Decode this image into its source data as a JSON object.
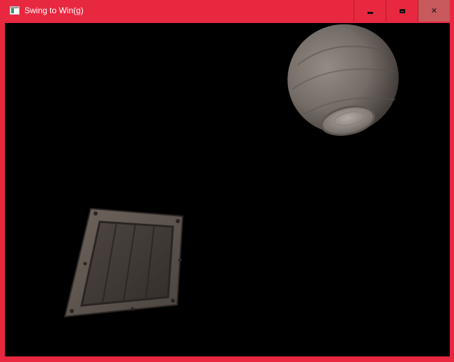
{
  "window": {
    "title": "Swing to Win(g)",
    "frame_color": "#e8283f",
    "close_hover_color": "#c8595c",
    "viewport_color": "#000000"
  },
  "controls": {
    "minimize": "minimize-icon",
    "maximize": "maximize-icon",
    "close": "close-icon"
  },
  "scene": {
    "objects": [
      {
        "kind": "wooden-barrel",
        "color": "#7a716b"
      },
      {
        "kind": "wooden-crate",
        "color": "#5a4f48"
      }
    ]
  }
}
